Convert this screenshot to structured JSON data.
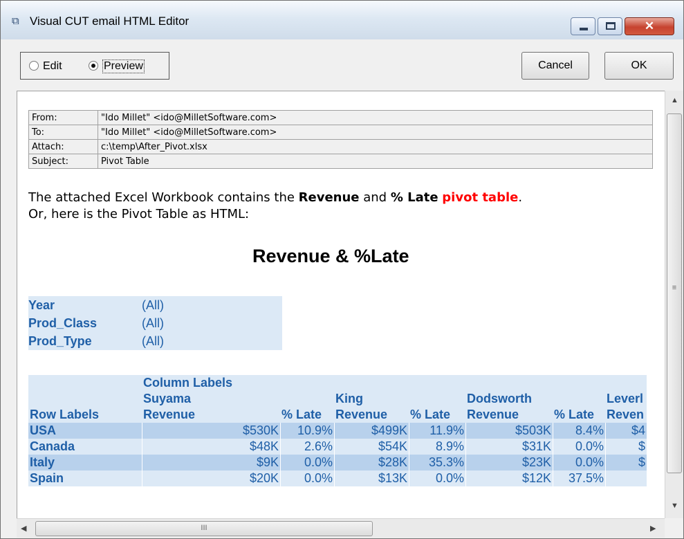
{
  "window": {
    "title": "Visual CUT email HTML Editor",
    "close_glyph": "✕",
    "icon": "app-window-icon"
  },
  "toolbar": {
    "modes": [
      {
        "label": "Edit",
        "checked": false
      },
      {
        "label": "Preview",
        "checked": true
      }
    ],
    "cancel_label": "Cancel",
    "ok_label": "OK"
  },
  "email": {
    "headers": [
      {
        "label": "From:",
        "value": "\"Ido Millet\" <ido@MilletSoftware.com>"
      },
      {
        "label": "To:",
        "value": "\"Ido Millet\" <ido@MilletSoftware.com>"
      },
      {
        "label": "Attach:",
        "value": "c:\\temp\\After_Pivot.xlsx"
      },
      {
        "label": "Subject:",
        "value": "Pivot Table"
      }
    ],
    "body": {
      "part1": "The attached Excel Workbook contains the ",
      "bold1": "Revenue",
      "part2": " and ",
      "bold2": "% Late",
      "part3": " ",
      "red": "pivot table",
      "part4": ".",
      "line2": "Or, here is the Pivot Table as HTML:"
    }
  },
  "pivot": {
    "title": "Revenue & %Late",
    "filters": [
      {
        "label": "Year",
        "value": "(All)"
      },
      {
        "label": "Prod_Class",
        "value": "(All)"
      },
      {
        "label": "Prod_Type",
        "value": "(All)"
      }
    ],
    "column_labels": "Column Labels",
    "row_labels": "Row Labels",
    "reps": [
      "Suyama",
      "King",
      "Dodsworth",
      "Leverl"
    ],
    "revenue_label": "Revenue",
    "revenue_label_cut": "Reven",
    "late_label": "% Late",
    "rows": [
      {
        "name": "USA",
        "cells": [
          "$530K",
          "10.9%",
          "$499K",
          "11.9%",
          "$503K",
          "8.4%",
          "$4"
        ]
      },
      {
        "name": "Canada",
        "cells": [
          "$48K",
          "2.6%",
          "$54K",
          "8.9%",
          "$31K",
          "0.0%",
          "$"
        ]
      },
      {
        "name": "Italy",
        "cells": [
          "$9K",
          "0.0%",
          "$28K",
          "35.3%",
          "$23K",
          "0.0%",
          "$"
        ]
      },
      {
        "name": "Spain",
        "cells": [
          "$20K",
          "0.0%",
          "$13K",
          "0.0%",
          "$12K",
          "37.5%",
          ""
        ]
      }
    ]
  },
  "scrollbars": {
    "v_grip": "≡",
    "h_grip": "III",
    "up_icon": "▲",
    "down_icon": "▼",
    "left_icon": "◀",
    "right_icon": "▶"
  }
}
